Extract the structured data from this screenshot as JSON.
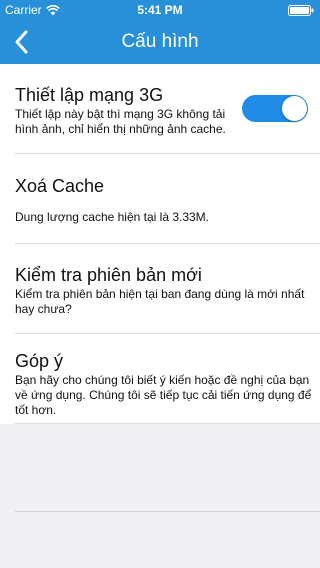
{
  "status_bar": {
    "carrier": "Carrier",
    "time": "5:41 PM"
  },
  "nav": {
    "title": "Cấu hình"
  },
  "settings": [
    {
      "title": "Thiết lập mạng 3G",
      "description": "Thiết lập này bật thì mạng 3G không tải hình ảnh, chỉ hiển thị những ảnh cache.",
      "toggle_on": true
    },
    {
      "title": "Xoá Cache",
      "description": "Dung lượng cache hiện tại là 3.33M."
    },
    {
      "title": "Kiểm tra phiên bản mới",
      "description": "Kiểm tra phiên bản hiện tại ban đang dùng là mới nhất hay chưa?"
    },
    {
      "title": "Góp ý",
      "description": "Bạn hãy cho chúng tôi biết ý kiến hoặc đề nghị của bạn về ứng dụng. Chúng tôi sẽ tiếp tục cải tiến ứng dụng để tốt hơn."
    }
  ],
  "colors": {
    "accent": "#2790d8",
    "toggle_on": "#1f8be5",
    "background": "#efeff4"
  },
  "icons": {
    "back": "chevron-left-icon",
    "wifi": "wifi-icon",
    "battery": "battery-icon"
  }
}
